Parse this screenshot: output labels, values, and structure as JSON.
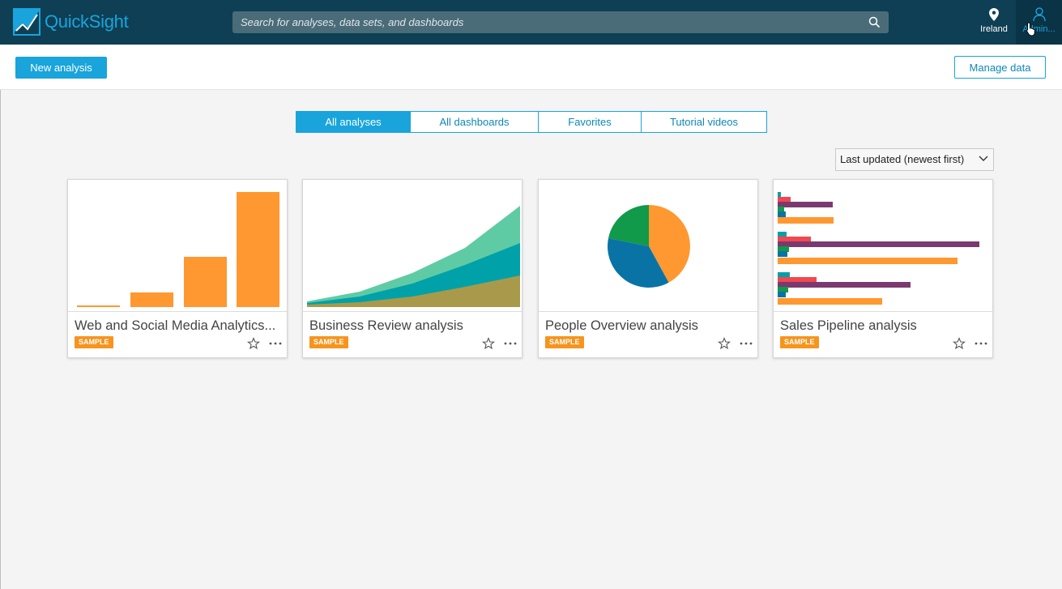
{
  "header": {
    "brand": "QuickSight",
    "search_placeholder": "Search for analyses, data sets, and dashboards",
    "region_label": "Ireland",
    "user_label": "Admin..."
  },
  "toolbar": {
    "new_analysis_label": "New analysis",
    "manage_data_label": "Manage data"
  },
  "tabs": [
    {
      "label": "All analyses",
      "active": true
    },
    {
      "label": "All dashboards",
      "active": false
    },
    {
      "label": "Favorites",
      "active": false
    },
    {
      "label": "Tutorial videos",
      "active": false
    }
  ],
  "sort": {
    "selected": "Last updated (newest first)"
  },
  "cards": [
    {
      "title": "Web and Social Media Analytics...",
      "badge": "SAMPLE",
      "thumbnail": "bar-chart"
    },
    {
      "title": "Business Review analysis",
      "badge": "SAMPLE",
      "thumbnail": "area-chart"
    },
    {
      "title": "People Overview analysis",
      "badge": "SAMPLE",
      "thumbnail": "pie-chart"
    },
    {
      "title": "Sales Pipeline analysis",
      "badge": "SAMPLE",
      "thumbnail": "horizontal-bar-chart"
    }
  ],
  "colors": {
    "brand": "#19a4dc",
    "header_bg": "#0e3f54",
    "sample_badge": "#f7941d",
    "chart_orange": "#ff9830",
    "chart_teal": "#00a1a9",
    "chart_green": "#5fcba5",
    "chart_olive": "#a89a4a",
    "chart_blue": "#0a73a6",
    "chart_dark_green": "#109a4a",
    "chart_purple": "#7b3a6f",
    "chart_red": "#f2474f"
  },
  "icons": [
    "quicksight-logo-icon",
    "search-icon",
    "location-pin-icon",
    "user-icon",
    "pointer-cursor-icon",
    "chevron-down-icon",
    "star-icon",
    "more-icon"
  ]
}
